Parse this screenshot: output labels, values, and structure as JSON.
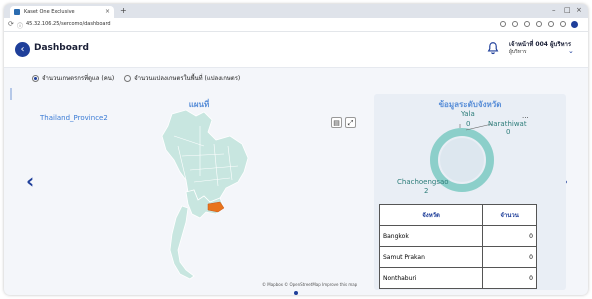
{
  "browser": {
    "tab_title": "Kaset One Exclusive",
    "tab_close": "×",
    "new_tab": "+",
    "url": "45.32.106.25/sercomo/dashboard",
    "window_controls": [
      "–",
      "□",
      "×"
    ]
  },
  "header": {
    "title": "Dashboard",
    "back_icon": "‹",
    "user_name": "เจ้าหน้าที่ 004 ผู้บริหาร",
    "user_role": "ผู้บริหาร",
    "chevron": "⌄"
  },
  "filters": {
    "options": [
      {
        "label": "จำนวนเกษตรกรที่ดูแล (คน)",
        "selected": true
      },
      {
        "label": "จำนวนแปลงเกษตรในพื้นที่ (แปลงเกษตร)",
        "selected": false
      }
    ]
  },
  "map_panel": {
    "title": "แผนที่",
    "layer_label": "Thailand_Province2",
    "attribution": "© Mapbox © OpenStreetMap Improve this map"
  },
  "stats_panel": {
    "title": "ข้อมูลระดับจังหวัด",
    "more": "...",
    "donut_labels": [
      {
        "name": "Yala",
        "value": "0"
      },
      {
        "name": "Narathiwat",
        "value": "0"
      },
      {
        "name": "Chachoengsao",
        "value": "2"
      }
    ],
    "table": {
      "headers": [
        "จังหวัด",
        "จำนวน"
      ],
      "rows": [
        [
          "Bangkok",
          "0"
        ],
        [
          "Samut Prakan",
          "0"
        ],
        [
          "Nonthaburi",
          "0"
        ]
      ]
    }
  },
  "carousel": {
    "prev": "‹",
    "next": "›"
  },
  "colors": {
    "accent": "#1f3f9a",
    "map_fill": "#c8e6e0",
    "highlight": "#e8741c",
    "donut": "#8ccfca"
  }
}
